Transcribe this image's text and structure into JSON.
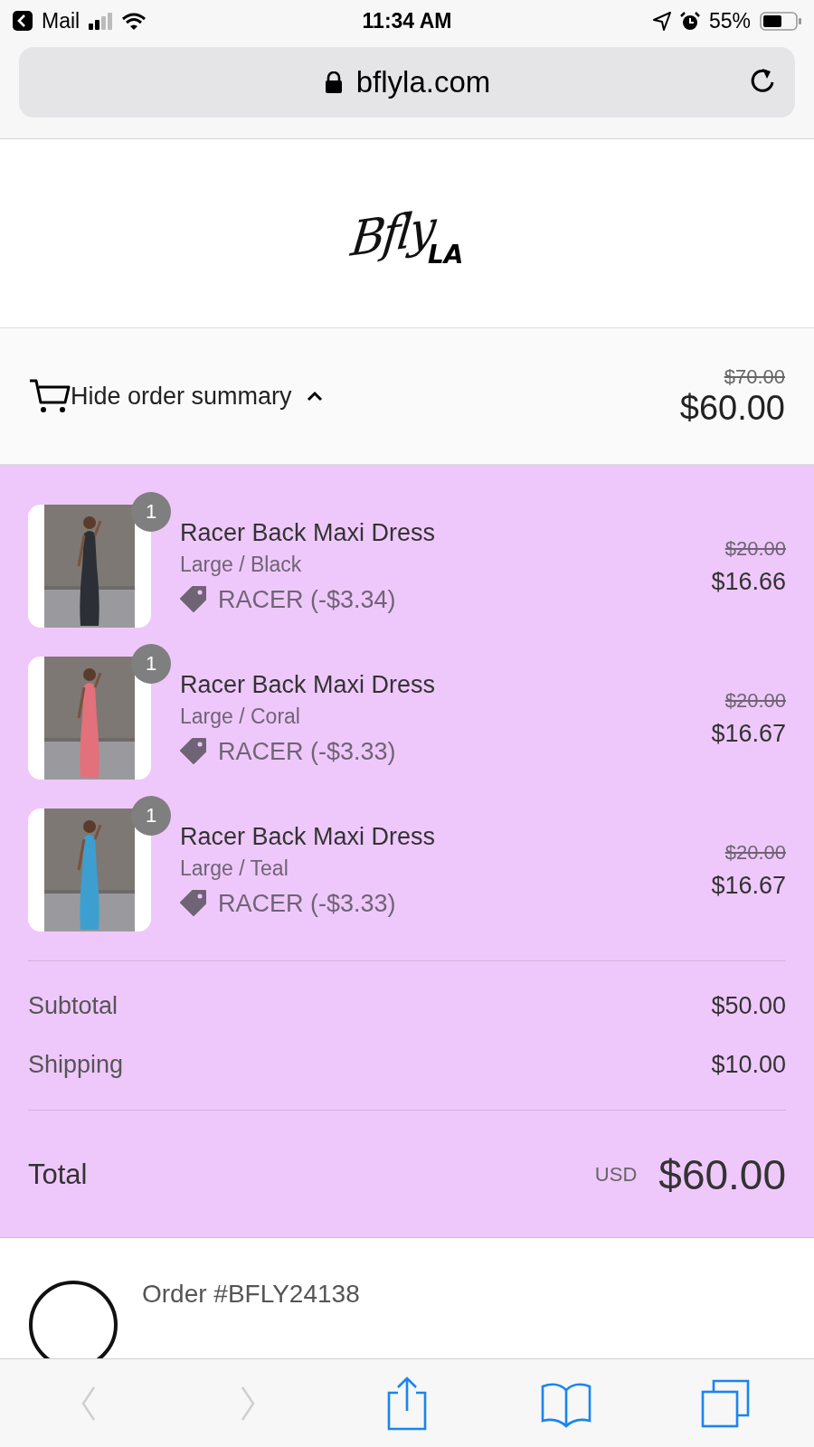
{
  "status_bar": {
    "back_app": "Mail",
    "time": "11:34 AM",
    "battery": "55%"
  },
  "address_bar": {
    "url": "bflyla.com"
  },
  "logo": {
    "script": "Bfly",
    "mark": "LA"
  },
  "summary_toggle": {
    "label": "Hide order summary",
    "expanded": true,
    "compare_total": "$70.00",
    "total": "$60.00"
  },
  "items": [
    {
      "quantity": "1",
      "title": "Racer Back Maxi Dress",
      "variant": "Large / Black",
      "discount": "RACER (-$3.34)",
      "compare_price": "$20.00",
      "price": "$16.66"
    },
    {
      "quantity": "1",
      "title": "Racer Back Maxi Dress",
      "variant": "Large / Coral",
      "discount": "RACER (-$3.33)",
      "compare_price": "$20.00",
      "price": "$16.67"
    },
    {
      "quantity": "1",
      "title": "Racer Back Maxi Dress",
      "variant": "Large / Teal",
      "discount": "RACER (-$3.33)",
      "compare_price": "$20.00",
      "price": "$16.67"
    }
  ],
  "totals": {
    "rows": [
      {
        "label": "Subtotal",
        "value": "$50.00"
      },
      {
        "label": "Shipping",
        "value": "$10.00"
      }
    ],
    "total_label": "Total",
    "currency": "USD",
    "total": "$60.00"
  },
  "order": {
    "number": "Order #BFLY24138"
  },
  "toolbar": [
    {
      "kind": "back",
      "disabled": true
    },
    {
      "kind": "forward",
      "disabled": true
    },
    {
      "kind": "share",
      "disabled": false
    },
    {
      "kind": "bookmarks",
      "disabled": false
    },
    {
      "kind": "tabs",
      "disabled": false
    }
  ]
}
